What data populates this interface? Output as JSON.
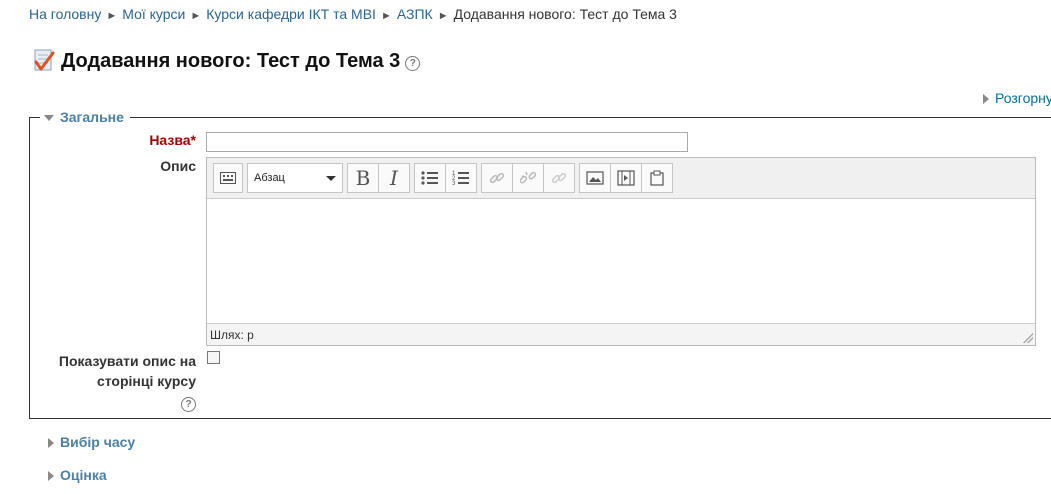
{
  "breadcrumb": {
    "items": [
      "На головну",
      "Мої курси",
      "Курси кафедри ІКТ та МВІ",
      "АЗПК"
    ],
    "current": "Додавання нового: Тест до Тема 3",
    "separator": "►"
  },
  "page": {
    "title": "Додавання нового: Тест до Тема 3",
    "help_glyph": "?",
    "expand_all": "Розгорну"
  },
  "general": {
    "legend": "Загальне",
    "name_label": "Назва",
    "required_mark": "*",
    "name_value": "",
    "description_label": "Опис",
    "editor": {
      "format_select": "Абзац",
      "path_label": "Шлях: p",
      "buttons": [
        "toggle-toolbar",
        "bold",
        "italic",
        "unordered-list",
        "ordered-list",
        "link",
        "unlink",
        "anchor",
        "image",
        "media",
        "paste"
      ]
    },
    "show_description_label_line1": "Показувати опис на",
    "show_description_label_line2": "сторінці курсу",
    "show_description_checked": false
  },
  "sections": [
    {
      "label": "Вибір часу"
    },
    {
      "label": "Оцінка"
    }
  ],
  "colors": {
    "link": "#2a6496",
    "legend": "#4a7fa8",
    "required": "#aa0000"
  }
}
